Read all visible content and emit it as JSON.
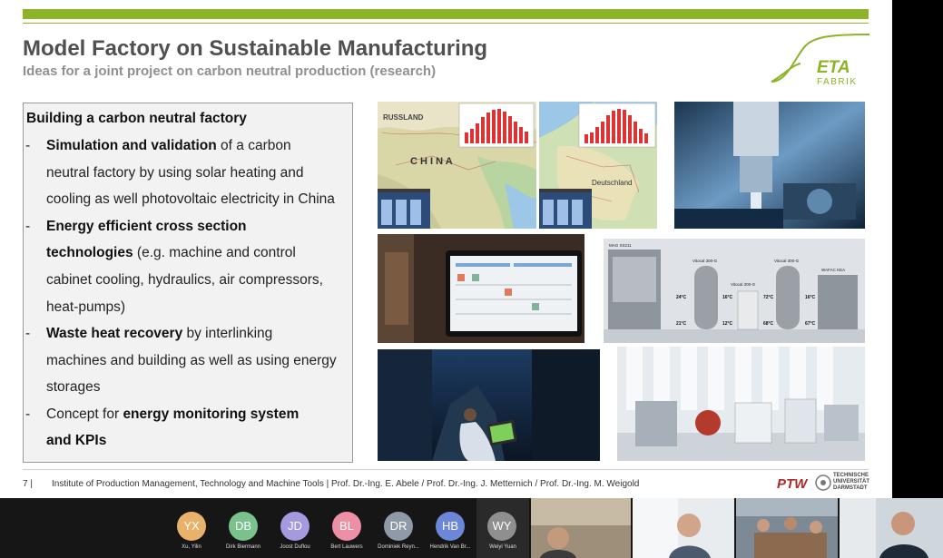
{
  "slide": {
    "title": "Model Factory on Sustainable Manufacturing",
    "subtitle": "Ideas for a joint project on carbon neutral production (research)",
    "logo": {
      "main": "ETA",
      "sub": "FABRIK"
    },
    "box": {
      "heading": "Building a carbon neutral factory",
      "dash": "-",
      "b1": {
        "bold": "Simulation and validation",
        "rest1": " of a carbon",
        "l2": "neutral factory by using solar heating and",
        "l3": "cooling as well photovoltaic electricity in China"
      },
      "b2": {
        "bold1": "Energy efficient cross section",
        "bold2": "technologies",
        "rest2": " (e.g. machine and control",
        "l3": "cabinet cooling, hydraulics, air compressors,",
        "l4": "heat-pumps)"
      },
      "b3": {
        "bold": "Waste heat recovery",
        "rest1": " by interlinking",
        "l2": "machines and building as well as using energy",
        "l3": "storages"
      },
      "b4": {
        "pre": "Concept for ",
        "bold1": "energy monitoring system",
        "bold2": "and KPIs"
      }
    },
    "map_labels": {
      "russland": "RUSSLAND",
      "china": "C H I N A",
      "deutschland": "Deutschland"
    },
    "tank_labels": [
      "MAG XS211",
      "Vitocal 300-G",
      "Vitocal 300-G",
      "Vitocal 300-G",
      "Vitocal 300-G",
      "WAFAC KEA"
    ],
    "temps": [
      "24°C",
      "16°C",
      "72°C",
      "16°C",
      "21°C",
      "12°C",
      "68°C",
      "67°C"
    ],
    "footer": {
      "page": "7 |",
      "text": "Institute of Production Management, Technology and Machine Tools | Prof. Dr.-Ing. E. Abele / Prof. Dr.-Ing. J. Metternich / Prof. Dr.-Ing. M. Weigold",
      "ptw": "PTW",
      "tud": [
        "TECHNISCHE",
        "UNIVERSITÄT",
        "DARMSTADT"
      ]
    }
  },
  "participants": [
    {
      "initials": "YX",
      "name": "Xu, Yilin",
      "color": "#e8b26a"
    },
    {
      "initials": "DB",
      "name": "Dirk Biermann",
      "color": "#79c28b"
    },
    {
      "initials": "JD",
      "name": "Joost Duflou",
      "color": "#a59ae0"
    },
    {
      "initials": "BL",
      "name": "Bert Lauwers",
      "color": "#ee8fa5"
    },
    {
      "initials": "DR",
      "name": "Dominiek Reyn...",
      "color": "#8f9aa8"
    },
    {
      "initials": "HB",
      "name": "Hendrik Van Br...",
      "color": "#6c86d8"
    },
    {
      "initials": "WY",
      "name": "Weiyi Yuan",
      "color": "#8f8f8f"
    }
  ]
}
